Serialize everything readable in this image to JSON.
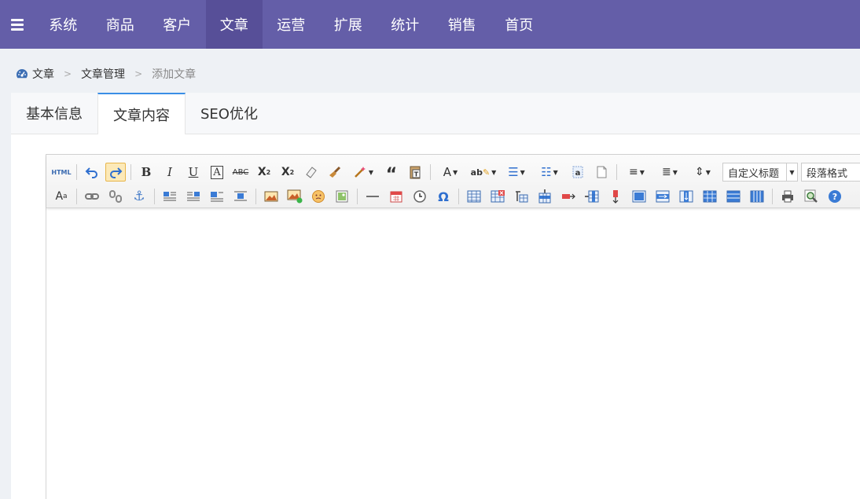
{
  "nav": {
    "items": [
      "系统",
      "商品",
      "客户",
      "文章",
      "运营",
      "扩展",
      "统计",
      "销售",
      "首页"
    ],
    "active_index": 3
  },
  "breadcrumb": {
    "items": [
      "文章",
      "文章管理",
      "添加文章"
    ],
    "separator": ">"
  },
  "tabs": {
    "items": [
      "基本信息",
      "文章内容",
      "SEO优化"
    ],
    "active_index": 1
  },
  "editor": {
    "toolbar": {
      "html_label": "HTML",
      "custom_heading_select": "自定义标题",
      "paragraph_format_select": "段落格式"
    },
    "content": ""
  },
  "colors": {
    "nav_bg": "#645ea8",
    "nav_active": "#574f98",
    "tab_active_border": "#3a8ee6",
    "page_bg": "#eef1f5"
  }
}
